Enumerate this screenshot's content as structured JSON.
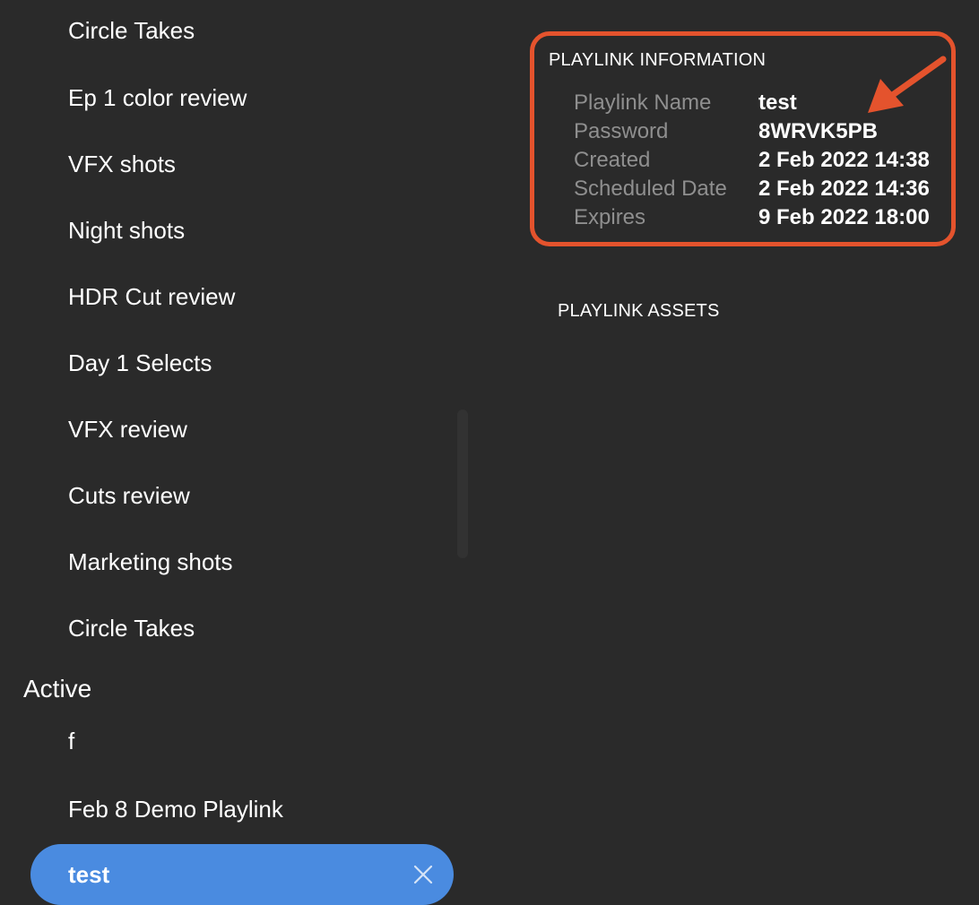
{
  "sidebar": {
    "items": [
      "Circle Takes",
      "Ep 1 color review",
      "VFX shots",
      "Night shots",
      "HDR Cut review",
      "Day 1 Selects",
      "VFX review",
      "Cuts review",
      "Marketing shots",
      "Circle Takes"
    ],
    "active_heading": "Active",
    "active_items": [
      "f",
      "Feb 8 Demo Playlink"
    ],
    "selected_item": "test"
  },
  "info": {
    "title": "PLAYLINK INFORMATION",
    "rows": [
      {
        "label": "Playlink Name",
        "value": "test"
      },
      {
        "label": "Password",
        "value": "8WRVK5PB"
      },
      {
        "label": "Created",
        "value": "2 Feb 2022 14:38"
      },
      {
        "label": "Scheduled Date",
        "value": "2 Feb 2022 14:36"
      },
      {
        "label": "Expires",
        "value": "9 Feb 2022 18:00"
      }
    ],
    "highlight_color": "#e4532d"
  },
  "assets": {
    "title": "PLAYLINK ASSETS"
  },
  "colors": {
    "background": "#2a2a2a",
    "selected_pill": "#4a8be0",
    "label_gray": "#8f8f8f"
  }
}
